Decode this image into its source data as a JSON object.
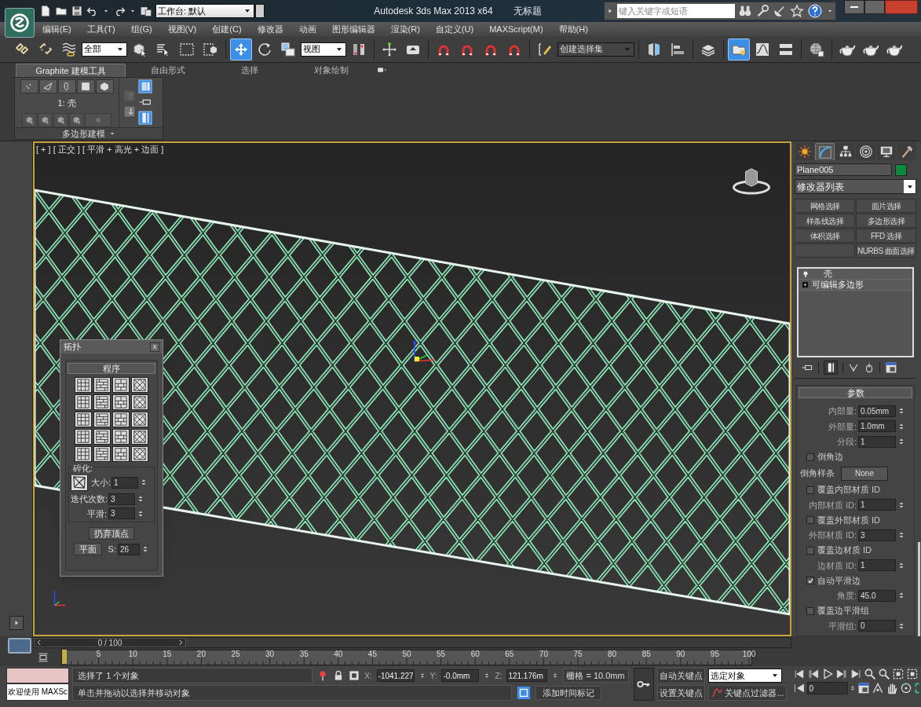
{
  "title_bar": {
    "workspace": "工作台: 默认",
    "app_title": "Autodesk 3ds Max  2013 x64",
    "document_title": "无标题",
    "search": {
      "placeholder": "键入关键字或短语"
    }
  },
  "menu": [
    "编辑(E)",
    "工具(T)",
    "组(G)",
    "视图(V)",
    "创建(C)",
    "修改器",
    "动画",
    "图形编辑器",
    "渲染(R)",
    "自定义(U)",
    "MAXScript(M)",
    "帮助(H)"
  ],
  "main_toolbar": {
    "selection_filter": "全部",
    "reference_coord": "视图",
    "named_selection": "创建选择集"
  },
  "ribbon": {
    "tabs": [
      {
        "label": "Graphite 建模工具",
        "selected": true
      },
      {
        "label": "自由形式",
        "selected": false
      },
      {
        "label": "选择",
        "selected": false
      },
      {
        "label": "对象绘制",
        "selected": false
      }
    ],
    "stack_label": "1: 壳",
    "panel_title": "多边形建模"
  },
  "viewport": {
    "label": "[ + ] [ 正交 ] [ 平滑 + 高光 + 边面 ]"
  },
  "topology_dialog": {
    "title": "拓扑",
    "close": "x",
    "rollout": "程序",
    "group": "碎化:",
    "fields": [
      {
        "label": "大小:",
        "value": "1"
      },
      {
        "label": "迭代次数:",
        "value": "3"
      },
      {
        "label": "平滑:",
        "value": "3"
      }
    ],
    "discard_button": "扔弃顶点",
    "plane_button": "平面",
    "seed": {
      "label": "S:",
      "value": "26"
    }
  },
  "command_panel": {
    "tabs": [
      {
        "selected": false
      },
      {
        "selected": true
      },
      {
        "selected": false
      },
      {
        "selected": false
      },
      {
        "selected": false
      },
      {
        "selected": false
      }
    ],
    "object_name": "Plane005",
    "modifier_list": "修改器列表",
    "modifier_buttons": [
      {
        "kind": "button",
        "label": "网格选择"
      },
      {
        "kind": "button",
        "label": "面片选择"
      },
      {
        "kind": "button",
        "label": "样条线选择"
      },
      {
        "kind": "button",
        "label": "多边形选择"
      },
      {
        "kind": "button",
        "label": "体积选择"
      },
      {
        "kind": "button",
        "label": "FFD 选择"
      },
      {
        "kind": "blank"
      },
      {
        "kind": "button",
        "label": "NURBS 曲面选择"
      }
    ],
    "stack": [
      {
        "kind": "modifier",
        "label": "壳"
      },
      {
        "kind": "base",
        "label": "可编辑多边形"
      }
    ],
    "parameters": {
      "title": "参数",
      "rows": [
        {
          "kind": "spinner",
          "label": "内部量:",
          "value": "0.05mm"
        },
        {
          "kind": "spinner",
          "label": "外部量:",
          "value": "1.0mm"
        },
        {
          "kind": "spinner",
          "label": "分段:",
          "value": "1"
        },
        {
          "kind": "checkbox",
          "label": "倒角边",
          "checked": false
        },
        {
          "kind": "picker",
          "label": "倒角样条",
          "value": "None"
        },
        {
          "kind": "checkbox",
          "label": "覆盖内部材质 ID",
          "checked": false
        },
        {
          "kind": "spinner",
          "label": "内部材质 ID:",
          "value": "1"
        },
        {
          "kind": "checkbox",
          "label": "覆盖外部材质 ID",
          "checked": false
        },
        {
          "kind": "spinner",
          "label": "外部材质 ID:",
          "value": "3"
        },
        {
          "kind": "checkbox",
          "label": "覆盖边材质 ID",
          "checked": false
        },
        {
          "kind": "spinner",
          "label": "边材质 ID:",
          "value": "1"
        },
        {
          "kind": "checkbox",
          "label": "自动平滑边",
          "checked": true
        },
        {
          "kind": "spinner",
          "label": "角度:",
          "value": "45.0"
        },
        {
          "kind": "checkbox",
          "label": "覆盖边平滑组",
          "checked": false
        },
        {
          "kind": "spinner",
          "label": "平滑组:",
          "value": "0"
        }
      ]
    }
  },
  "timeline": {
    "frame": "0 / 100",
    "level": 0,
    "ticks": [
      "5",
      "10",
      "15",
      "20",
      "25",
      "30",
      "35",
      "40",
      "45",
      "50",
      "55",
      "60",
      "65",
      "70",
      "75",
      "80",
      "85",
      "90",
      "95",
      "100"
    ]
  },
  "status_bar": {
    "listener": "欢迎使用 MAXSc",
    "selection": "选择了 1 个对象",
    "prompt": "单击并拖动以选择并移动对象",
    "x": {
      "label": "X:",
      "value": "-1041.227"
    },
    "y": {
      "label": "Y:",
      "value": "-0.0mm"
    },
    "z": {
      "label": "Z:",
      "value": "121.176m"
    },
    "grid": "栅格 = 10.0mm",
    "add_time_tag": "添加时间标记",
    "auto_key": "自动关键点",
    "set_key": "设置关键点",
    "key_mode": "选定对象",
    "key_filters": "关键点过滤器...",
    "current_frame": "0"
  }
}
